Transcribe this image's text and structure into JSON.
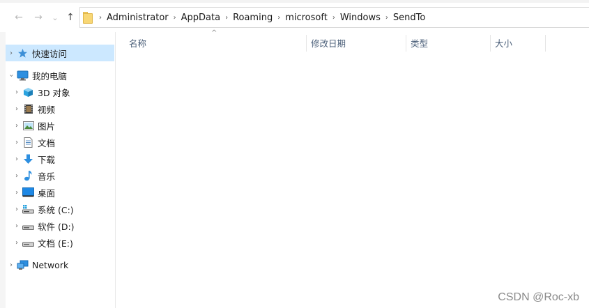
{
  "nav": {
    "back_glyph": "←",
    "forward_glyph": "→",
    "recent_glyph": "⌄",
    "up_glyph": "↑"
  },
  "breadcrumbs": [
    "Administrator",
    "AppData",
    "Roaming",
    "microsoft",
    "Windows",
    "SendTo"
  ],
  "columns": {
    "name": "名称",
    "modified": "修改日期",
    "type": "类型",
    "size": "大小",
    "sort_indicator": "^"
  },
  "sidebar": {
    "quick_access": "快速访问",
    "this_pc": "我的电脑",
    "items": [
      {
        "label": "3D 对象",
        "icon": "cube-icon"
      },
      {
        "label": "视频",
        "icon": "film-icon"
      },
      {
        "label": "图片",
        "icon": "picture-icon"
      },
      {
        "label": "文档",
        "icon": "document-icon"
      },
      {
        "label": "下载",
        "icon": "download-arrow-icon"
      },
      {
        "label": "音乐",
        "icon": "music-note-icon"
      },
      {
        "label": "桌面",
        "icon": "desktop-icon"
      },
      {
        "label": "系统 (C:)",
        "icon": "system-drive-icon"
      },
      {
        "label": "软件 (D:)",
        "icon": "drive-icon"
      },
      {
        "label": "文档 (E:)",
        "icon": "drive-icon"
      }
    ],
    "network": "Network"
  },
  "watermark": "CSDN @Roc-xb",
  "colors": {
    "selected_bg": "#cce8ff",
    "header_text": "#4c607a",
    "accent_blue": "#1e88e5"
  }
}
